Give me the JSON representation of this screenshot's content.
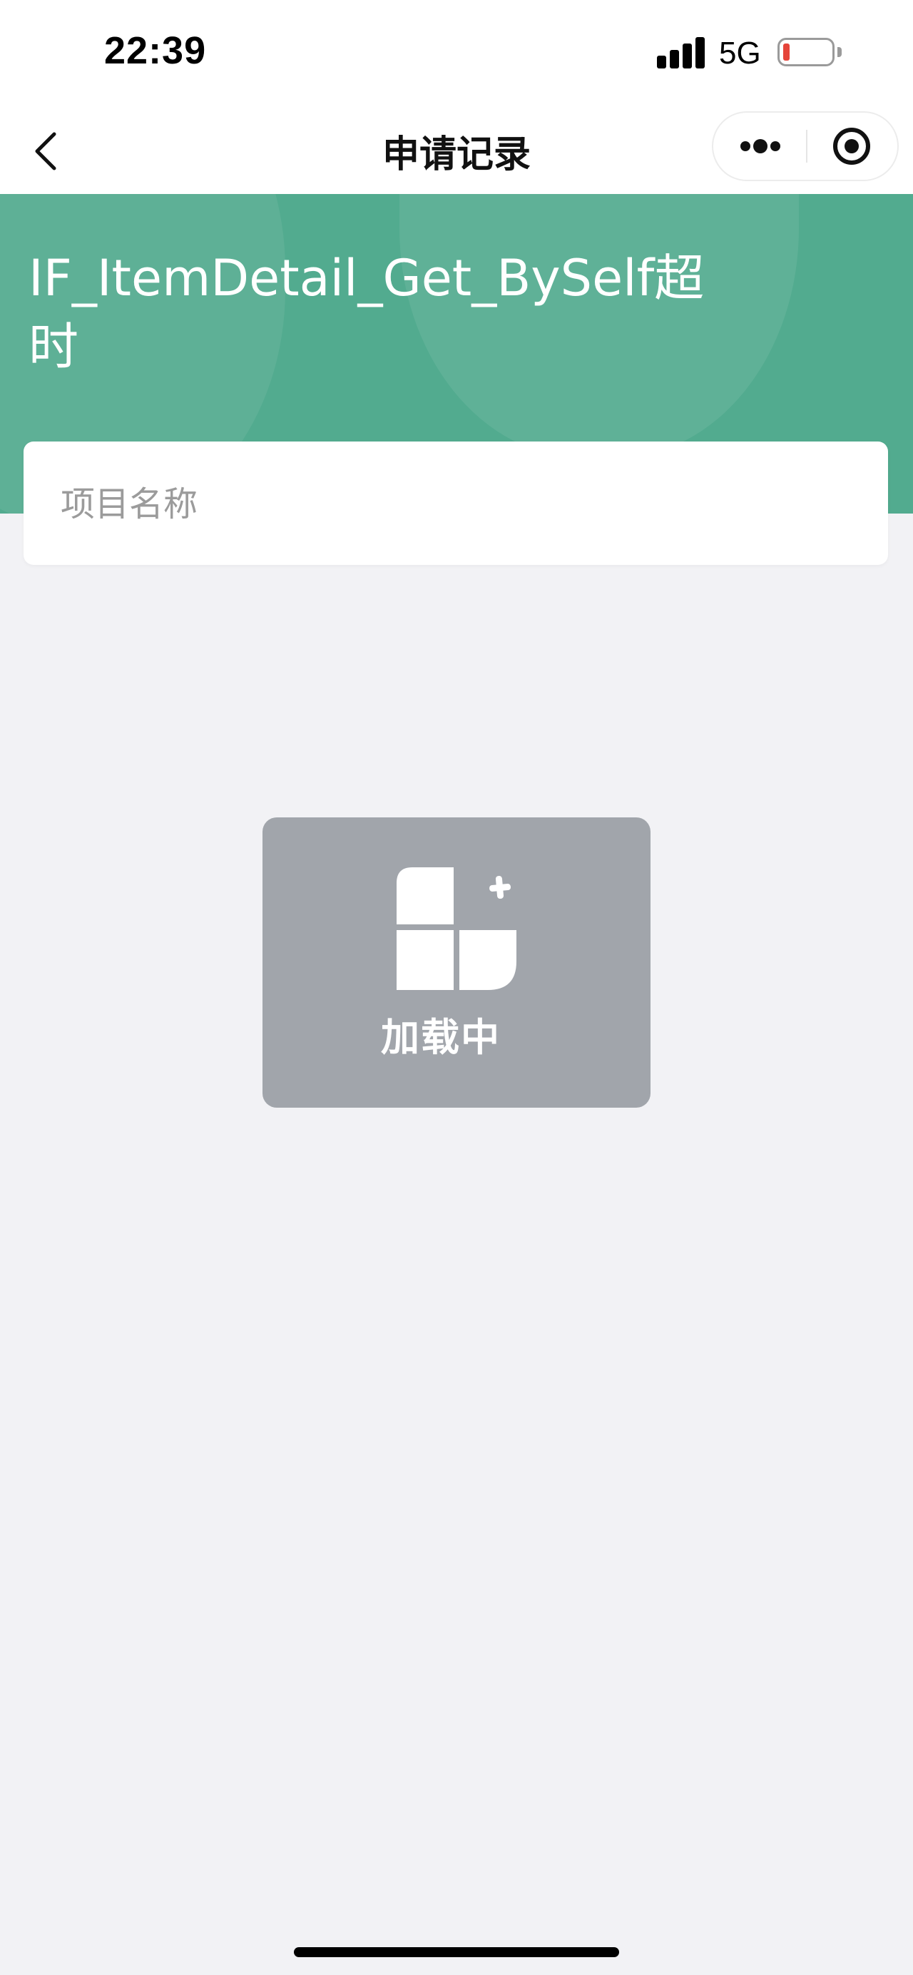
{
  "status_bar": {
    "time": "22:39",
    "network": "5G",
    "icons": [
      "signal-icon",
      "battery-low-icon"
    ]
  },
  "nav": {
    "title": "申请记录",
    "icons": [
      "back-chevron-icon",
      "more-dots-icon",
      "close-target-icon"
    ]
  },
  "banner": {
    "title": "IF_ItemDetail_Get_BySelf超时",
    "color": "#52ab8f"
  },
  "search": {
    "placeholder": "项目名称",
    "value": ""
  },
  "loading": {
    "text": "加载中",
    "icon": "loading-blocks-icon"
  },
  "colors": {
    "accent": "#52ab8f",
    "page_background": "#f2f2f5",
    "toast_background": "#a1a5ab",
    "battery_low": "#e5443a"
  }
}
